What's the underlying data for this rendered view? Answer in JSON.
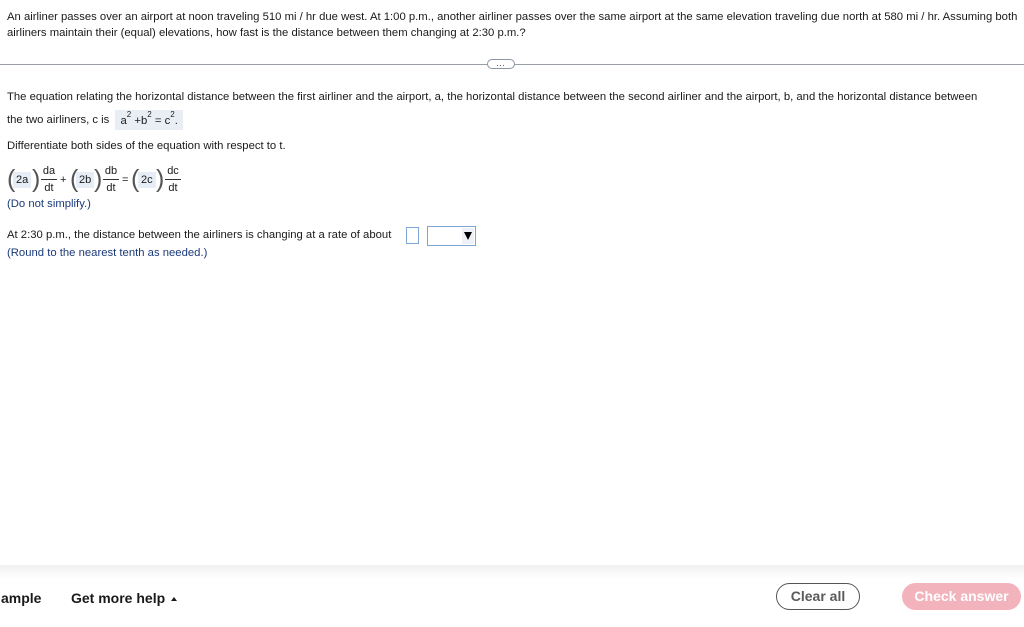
{
  "question": {
    "text": "An airliner passes over an airport at noon traveling 510 mi / hr due west. At 1:00 p.m., another airliner passes over the same airport at the same elevation traveling due north at 580 mi / hr. Assuming both airliners maintain their (equal) elevations, how fast is the distance between them changing at 2:30 p.m.?"
  },
  "divider": {
    "expand_label": "…"
  },
  "step1": {
    "line1": "The equation relating the horizontal distance between the first airliner and the airport, a, the horizontal distance between the second airliner and the airport, b, and the horizontal distance between",
    "line2": "the two airliners, c is",
    "eq_a": "a",
    "eq_b": "b",
    "eq_c": "c",
    "eq_exp": "2",
    "eq_plus": "+",
    "eq_equals": "=",
    "eq_end": "."
  },
  "step2": {
    "text": "Differentiate both sides of the equation with respect to t."
  },
  "derivative": {
    "ans1": "2a",
    "ans2": "2b",
    "ans3": "2c",
    "frac1": {
      "num": "da",
      "den": "dt"
    },
    "frac2": {
      "num": "db",
      "den": "dt"
    },
    "frac3": {
      "num": "dc",
      "den": "dt"
    },
    "plus": "+",
    "equals": "=",
    "hint": "(Do not simplify.)"
  },
  "rate": {
    "text": "At 2:30 p.m., the distance between the airliners is changing at a rate of about",
    "input_value": "",
    "unit_value": "",
    "hint": "(Round to the nearest tenth as needed.)"
  },
  "footer": {
    "example_label": "ample",
    "help_label": "Get more help",
    "clear_label": "Clear all",
    "check_label": "Check answer"
  },
  "colors": {
    "answer_bg": "#e6edf6",
    "hint": "#1b3a7a",
    "check_button": "#f2b3bd",
    "input_border": "#7fa5d6"
  }
}
